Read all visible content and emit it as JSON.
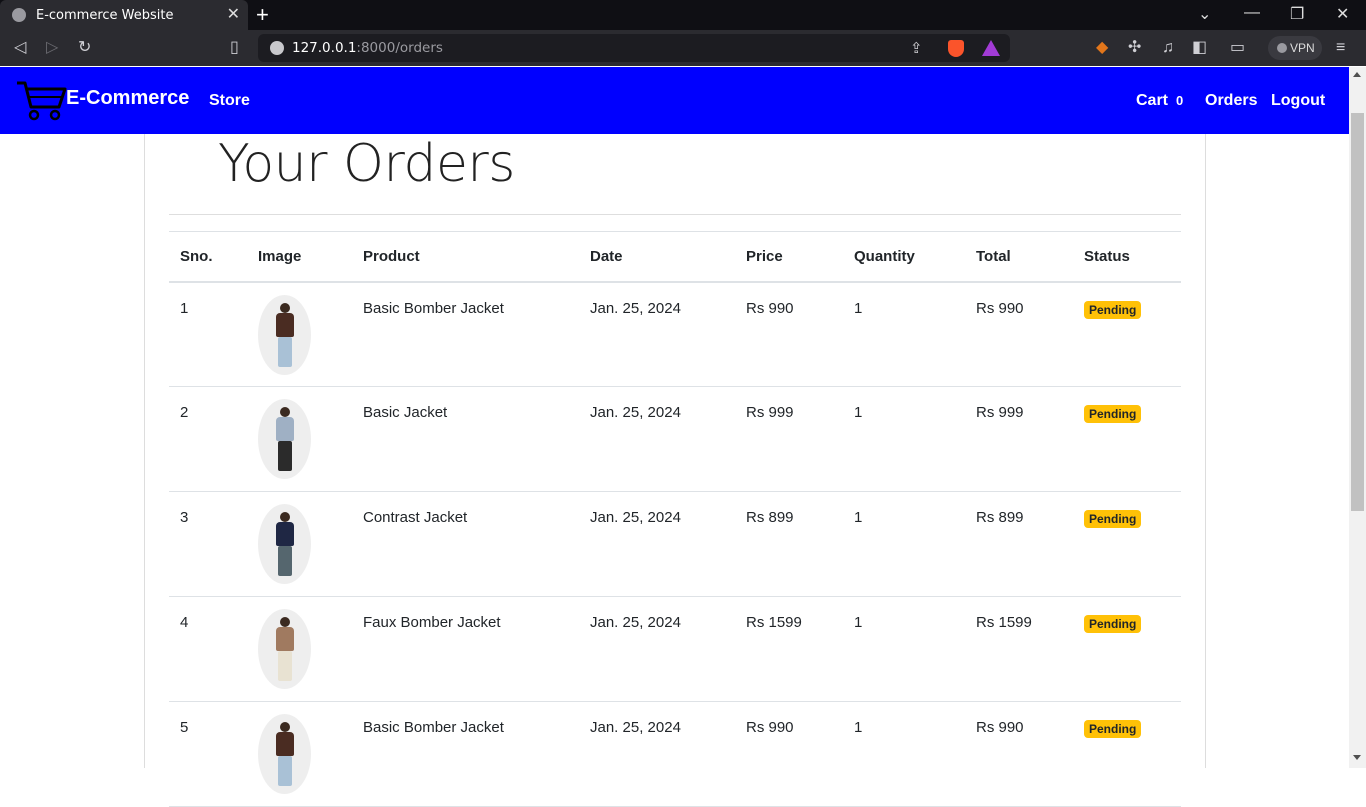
{
  "browser": {
    "tab_title": "E-commerce Website",
    "url_host": "127.0.0.1",
    "url_rest": ":8000/orders",
    "vpn_label": "VPN"
  },
  "navbar": {
    "brand": "E-Commerce",
    "store": "Store",
    "cart": "Cart",
    "cart_count": "0",
    "orders": "Orders",
    "logout": "Logout",
    "color": "#0000ff"
  },
  "page": {
    "title": "Your Orders"
  },
  "table": {
    "headers": [
      "Sno.",
      "Image",
      "Product",
      "Date",
      "Price",
      "Quantity",
      "Total",
      "Status"
    ],
    "rows": [
      {
        "sno": "1",
        "product": "Basic Bomber Jacket",
        "date": "Jan. 25, 2024",
        "price": "Rs 990",
        "quantity": "1",
        "total": "Rs 990",
        "status": "Pending",
        "jacket_color": "#4a2c22",
        "pants_color": "#a9c1d6"
      },
      {
        "sno": "2",
        "product": "Basic Jacket",
        "date": "Jan. 25, 2024",
        "price": "Rs 999",
        "quantity": "1",
        "total": "Rs 999",
        "status": "Pending",
        "jacket_color": "#9fb0c4",
        "pants_color": "#2b2b2b"
      },
      {
        "sno": "3",
        "product": "Contrast Jacket",
        "date": "Jan. 25, 2024",
        "price": "Rs 899",
        "quantity": "1",
        "total": "Rs 899",
        "status": "Pending",
        "jacket_color": "#1f2744",
        "pants_color": "#55666e"
      },
      {
        "sno": "4",
        "product": "Faux Bomber Jacket",
        "date": "Jan. 25, 2024",
        "price": "Rs 1599",
        "quantity": "1",
        "total": "Rs 1599",
        "status": "Pending",
        "jacket_color": "#a07a60",
        "pants_color": "#e8e2d2"
      },
      {
        "sno": "5",
        "product": "Basic Bomber Jacket",
        "date": "Jan. 25, 2024",
        "price": "Rs 990",
        "quantity": "1",
        "total": "Rs 990",
        "status": "Pending",
        "jacket_color": "#4a2c22",
        "pants_color": "#a9c1d6"
      }
    ]
  },
  "colors": {
    "badge": "#ffc107"
  }
}
